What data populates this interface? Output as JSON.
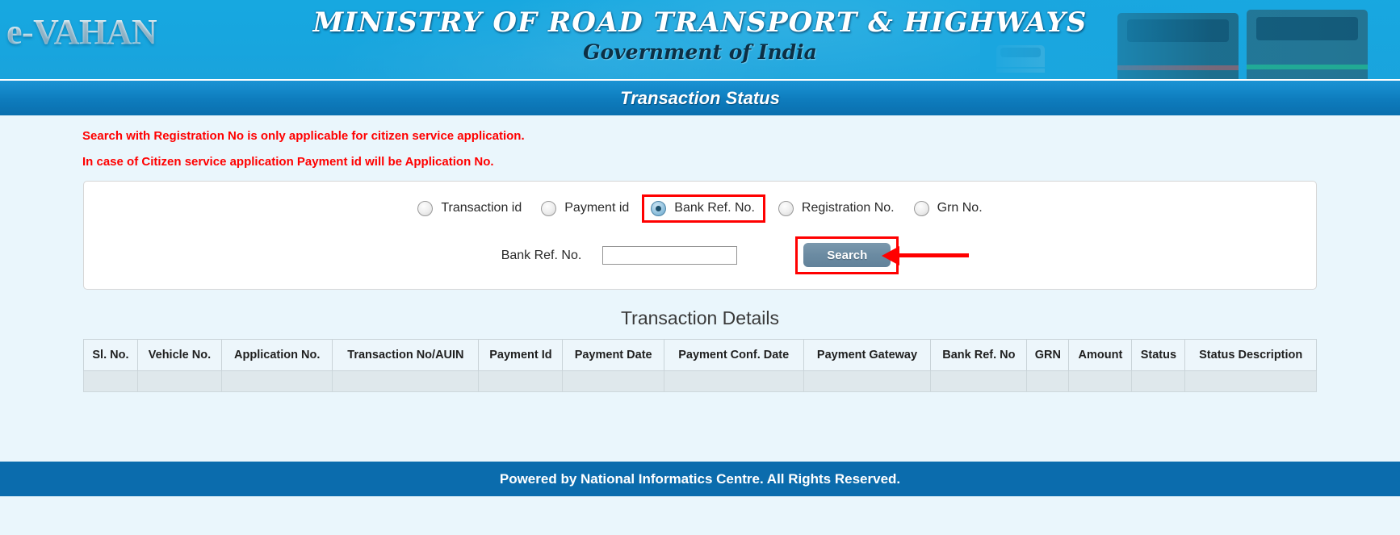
{
  "banner": {
    "logo": "e-VAHAN",
    "ministry": "MINISTRY OF ROAD TRANSPORT & HIGHWAYS",
    "government": "Government of India",
    "photo_alt": "bus-truck-imagery"
  },
  "page": {
    "title": "Transaction Status",
    "notices": [
      "Search with Registration No is only applicable for citizen service application.",
      "In case of Citizen service application Payment id will be Application No."
    ]
  },
  "search_form": {
    "options": [
      {
        "label": "Transaction id",
        "selected": false
      },
      {
        "label": "Payment id",
        "selected": false
      },
      {
        "label": "Bank Ref. No.",
        "selected": true
      },
      {
        "label": "Registration No.",
        "selected": false
      },
      {
        "label": "Grn No.",
        "selected": false
      }
    ],
    "field_label": "Bank Ref. No.",
    "field_value": "",
    "field_placeholder": "",
    "search_label": "Search"
  },
  "details": {
    "heading": "Transaction Details",
    "columns": [
      "Sl. No.",
      "Vehicle No.",
      "Application No.",
      "Transaction No/AUIN",
      "Payment Id",
      "Payment Date",
      "Payment Conf. Date",
      "Payment Gateway",
      "Bank Ref. No",
      "GRN",
      "Amount",
      "Status",
      "Status Description"
    ],
    "rows": [
      [
        "",
        "",
        "",
        "",
        "",
        "",
        "",
        "",
        "",
        "",
        "",
        "",
        ""
      ]
    ]
  },
  "footer": {
    "text": "Powered by National Informatics Centre. All Rights Reserved."
  },
  "colors": {
    "banner_blue": "#17a6df",
    "title_blue": "#0e7cbd",
    "footer_blue": "#0b6cad",
    "page_bg": "#eaf6fc",
    "notice_red": "#ff0000",
    "highlight_red": "#ff0000",
    "search_button": "#6b8ba2",
    "table_header_bg": "#edf6fb",
    "table_row_bg": "#dfe8ec"
  }
}
